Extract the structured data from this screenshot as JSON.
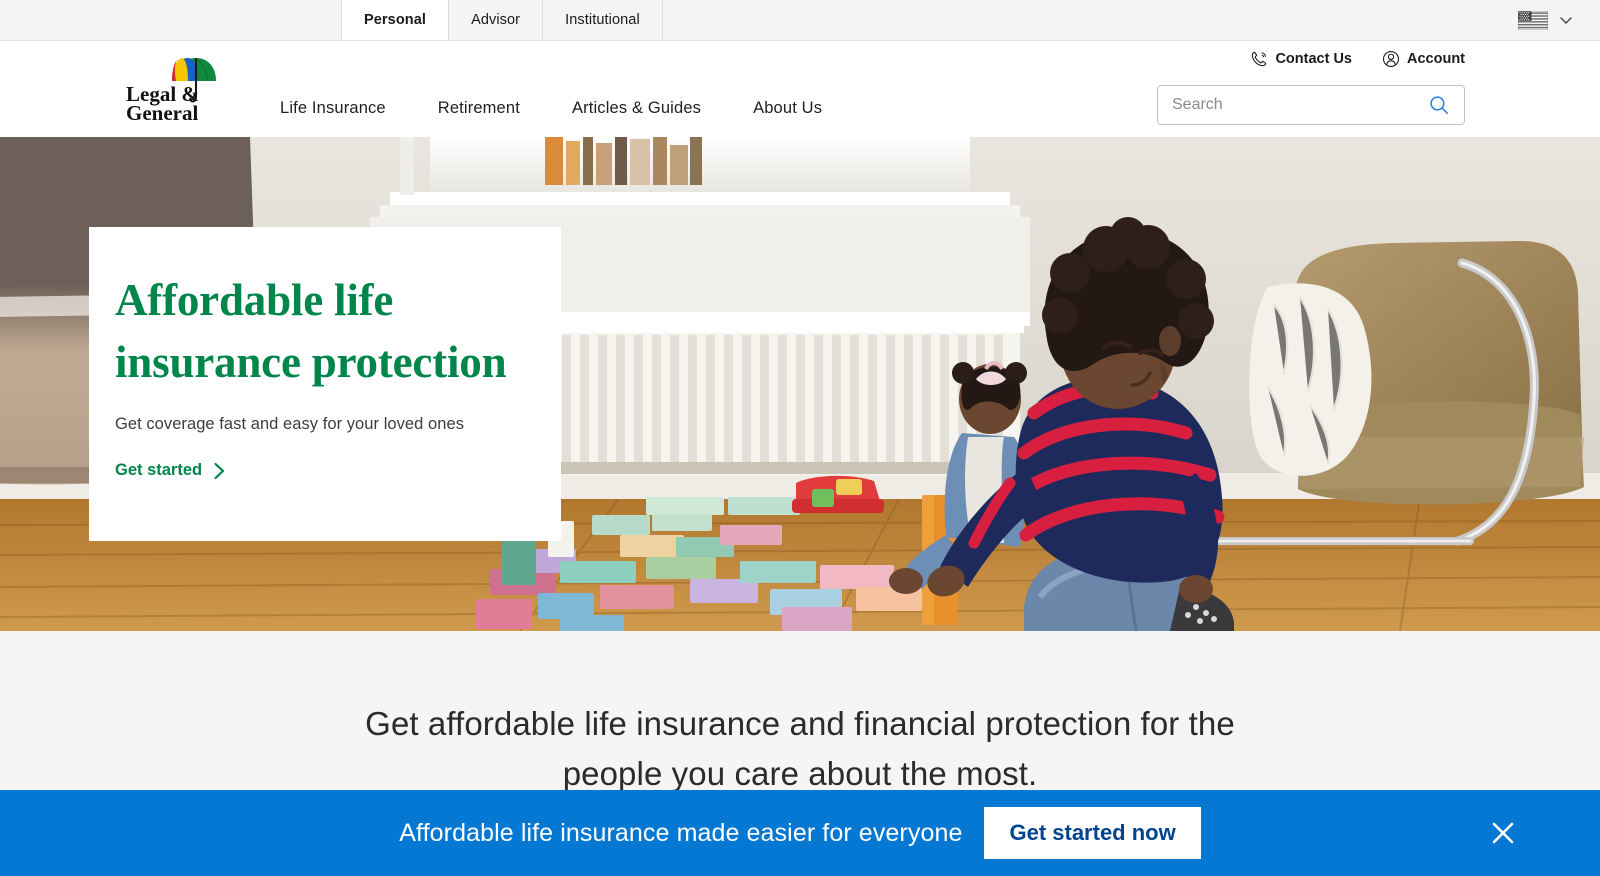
{
  "audience_bar": {
    "tabs": [
      {
        "label": "Personal",
        "active": true
      },
      {
        "label": "Advisor",
        "active": false
      },
      {
        "label": "Institutional",
        "active": false
      }
    ],
    "locale_flag": "us-flag-icon",
    "locale_chevron": "chevron-down-icon"
  },
  "header": {
    "logo": {
      "line1": "Legal &",
      "line2": "General",
      "icon": "umbrella-icon",
      "umbrella_colors": [
        "#d62828",
        "#f7c600",
        "#1463c6",
        "#0f8a3c"
      ]
    },
    "utility": [
      {
        "label": "Contact Us",
        "icon": "phone-icon"
      },
      {
        "label": "Account",
        "icon": "user-icon"
      }
    ],
    "search": {
      "placeholder": "Search",
      "value": "",
      "icon": "search-icon",
      "icon_color": "#2a7fd4"
    },
    "nav": [
      {
        "label": "Life Insurance"
      },
      {
        "label": "Retirement"
      },
      {
        "label": "Articles & Guides"
      },
      {
        "label": "About Us"
      }
    ]
  },
  "hero": {
    "title": "Affordable life insurance protection",
    "subtitle": "Get coverage fast and easy for your loved ones",
    "cta_label": "Get started",
    "cta_icon": "chevron-right-icon",
    "accent_color": "#00854a",
    "image_alt": "Two children playing with colorful wooden blocks on a wood floor in a living room"
  },
  "intro": {
    "text": "Get affordable life insurance and financial protection for the people you care about the most."
  },
  "sticky_banner": {
    "text": "Affordable life insurance made easier for everyone",
    "button_label": "Get started now",
    "close_icon": "close-icon",
    "background_color": "#0578d3",
    "button_text_color": "#00448f"
  }
}
